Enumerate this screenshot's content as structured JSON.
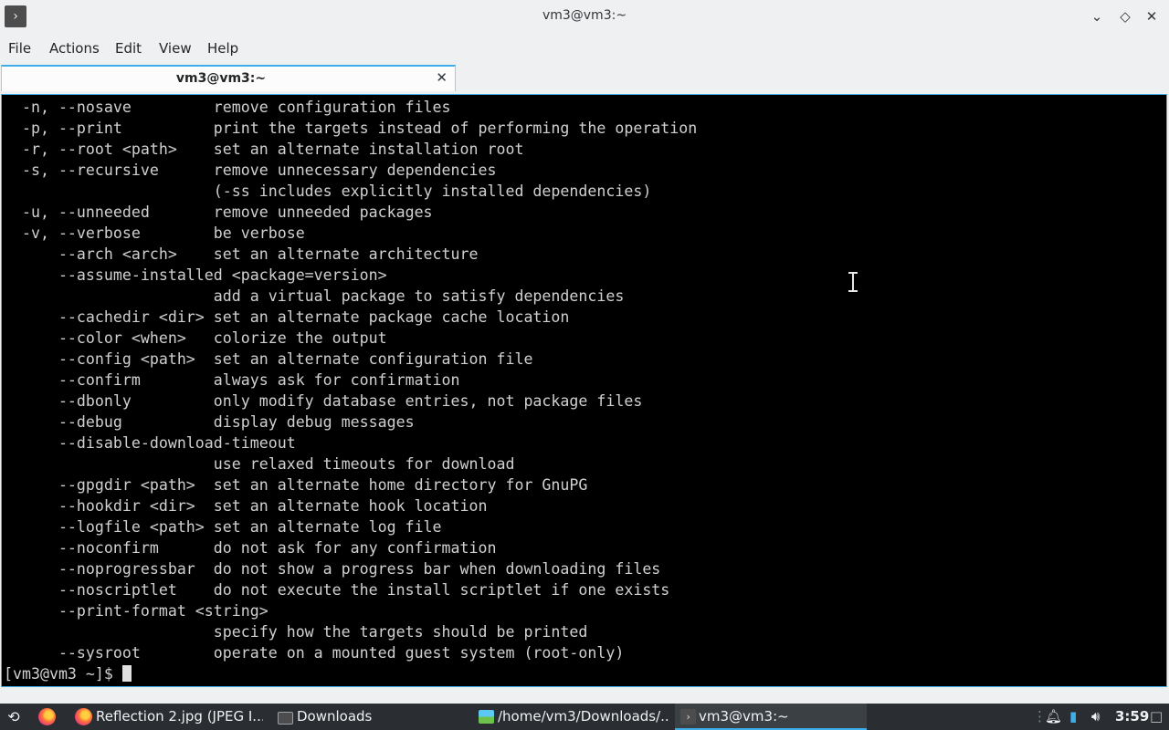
{
  "window": {
    "title": "vm3@vm3:~",
    "app_icon": "terminal-icon",
    "controls": [
      "minimize-icon",
      "maximize-icon",
      "close-icon"
    ]
  },
  "menu": [
    "File",
    "Actions",
    "Edit",
    "View",
    "Help"
  ],
  "tab": {
    "label": "vm3@vm3:~"
  },
  "terminal": {
    "lines": [
      "  -n, --nosave         remove configuration files",
      "  -p, --print          print the targets instead of performing the operation",
      "  -r, --root <path>    set an alternate installation root",
      "  -s, --recursive      remove unnecessary dependencies",
      "                       (-ss includes explicitly installed dependencies)",
      "  -u, --unneeded       remove unneeded packages",
      "  -v, --verbose        be verbose",
      "      --arch <arch>    set an alternate architecture",
      "      --assume-installed <package=version>",
      "                       add a virtual package to satisfy dependencies",
      "      --cachedir <dir> set an alternate package cache location",
      "      --color <when>   colorize the output",
      "      --config <path>  set an alternate configuration file",
      "      --confirm        always ask for confirmation",
      "      --dbonly         only modify database entries, not package files",
      "      --debug          display debug messages",
      "      --disable-download-timeout",
      "                       use relaxed timeouts for download",
      "      --gpgdir <path>  set an alternate home directory for GnuPG",
      "      --hookdir <dir>  set an alternate hook location",
      "      --logfile <path> set an alternate log file",
      "      --noconfirm      do not ask for any confirmation",
      "      --noprogressbar  do not show a progress bar when downloading files",
      "      --noscriptlet    do not execute the install scriptlet if one exists",
      "      --print-format <string>",
      "                       specify how the targets should be printed",
      "      --sysroot        operate on a mounted guest system (root-only)"
    ],
    "prompt": "[vm3@vm3 ~]$ "
  },
  "taskbar": {
    "tasks": [
      {
        "label": "Reflection 2.jpg (JPEG I...",
        "icon": "firefox-icon"
      },
      {
        "label": "Downloads",
        "icon": "folder-icon"
      },
      {
        "label": "/home/vm3/Downloads/...",
        "icon": "image-viewer-icon"
      },
      {
        "label": "vm3@vm3:~",
        "icon": "terminal-icon",
        "active": true
      }
    ],
    "clock": "3:59"
  },
  "colors": {
    "accent": "#3daee9",
    "terminal_bg": "#000000",
    "terminal_fg": "#d0d0d0",
    "taskbar_bg": "#2a2e32"
  }
}
